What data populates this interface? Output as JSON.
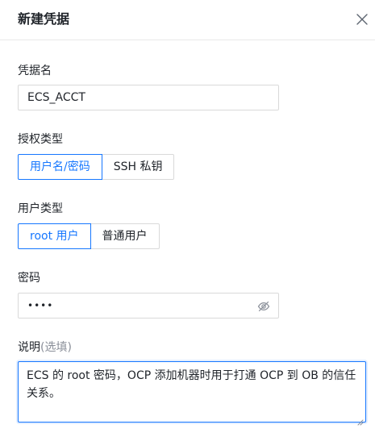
{
  "dialog": {
    "title": "新建凭据",
    "close_icon": "close-icon"
  },
  "form": {
    "credential_name": {
      "label": "凭据名",
      "value": "ECS_ACCT"
    },
    "auth_type": {
      "label": "授权类型",
      "options": [
        "用户名/密码",
        "SSH 私钥"
      ],
      "selected": "用户名/密码"
    },
    "user_type": {
      "label": "用户类型",
      "options": [
        "root 用户",
        "普通用户"
      ],
      "selected": "root 用户"
    },
    "password": {
      "label": "密码",
      "value": "••••",
      "toggle_icon": "eye-invisible-icon"
    },
    "description": {
      "label": "说明",
      "optional_hint": "(选填)",
      "value": "ECS 的 root 密码，OCP 添加机器时用于打通 OCP 到 OB 的信任关系。"
    }
  },
  "colors": {
    "accent": "#1677ff",
    "border": "#d9d9d9",
    "text": "#1f2329",
    "muted": "#8a8f99"
  }
}
